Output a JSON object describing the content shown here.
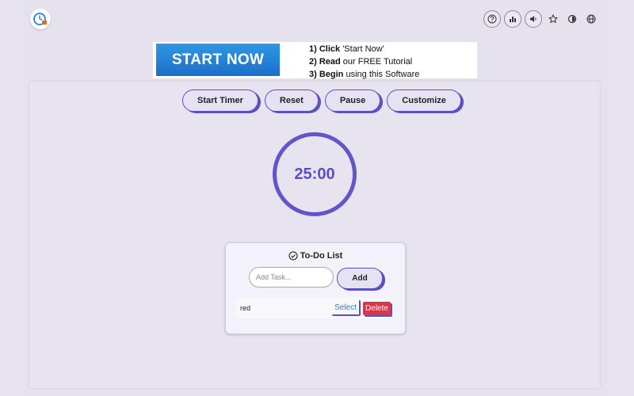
{
  "top_icons": [
    "help-icon",
    "stats-icon",
    "volume-icon",
    "star-icon",
    "brightness-icon",
    "globe-icon"
  ],
  "banner": {
    "cta": "START NOW",
    "step1_bold": "1) Click",
    "step1_rest": " 'Start Now'",
    "step2_bold": "2) Read",
    "step2_rest": " our FREE Tutorial",
    "step3_bold": "3) Begin",
    "step3_rest": "  using  this Software"
  },
  "controls": {
    "start": "Start Timer",
    "reset": "Reset",
    "pause": "Pause",
    "customize": "Customize"
  },
  "timer": {
    "display": "25:00"
  },
  "todo": {
    "title": "To-Do List",
    "input_placeholder": "Add Task...",
    "input_value": "",
    "add_label": "Add",
    "tasks": [
      {
        "text": "red",
        "select_label": "Select",
        "delete_label": "Delete"
      }
    ]
  },
  "colors": {
    "accent": "#5b52c2",
    "timer": "#6155c7",
    "danger": "#d9364a"
  }
}
